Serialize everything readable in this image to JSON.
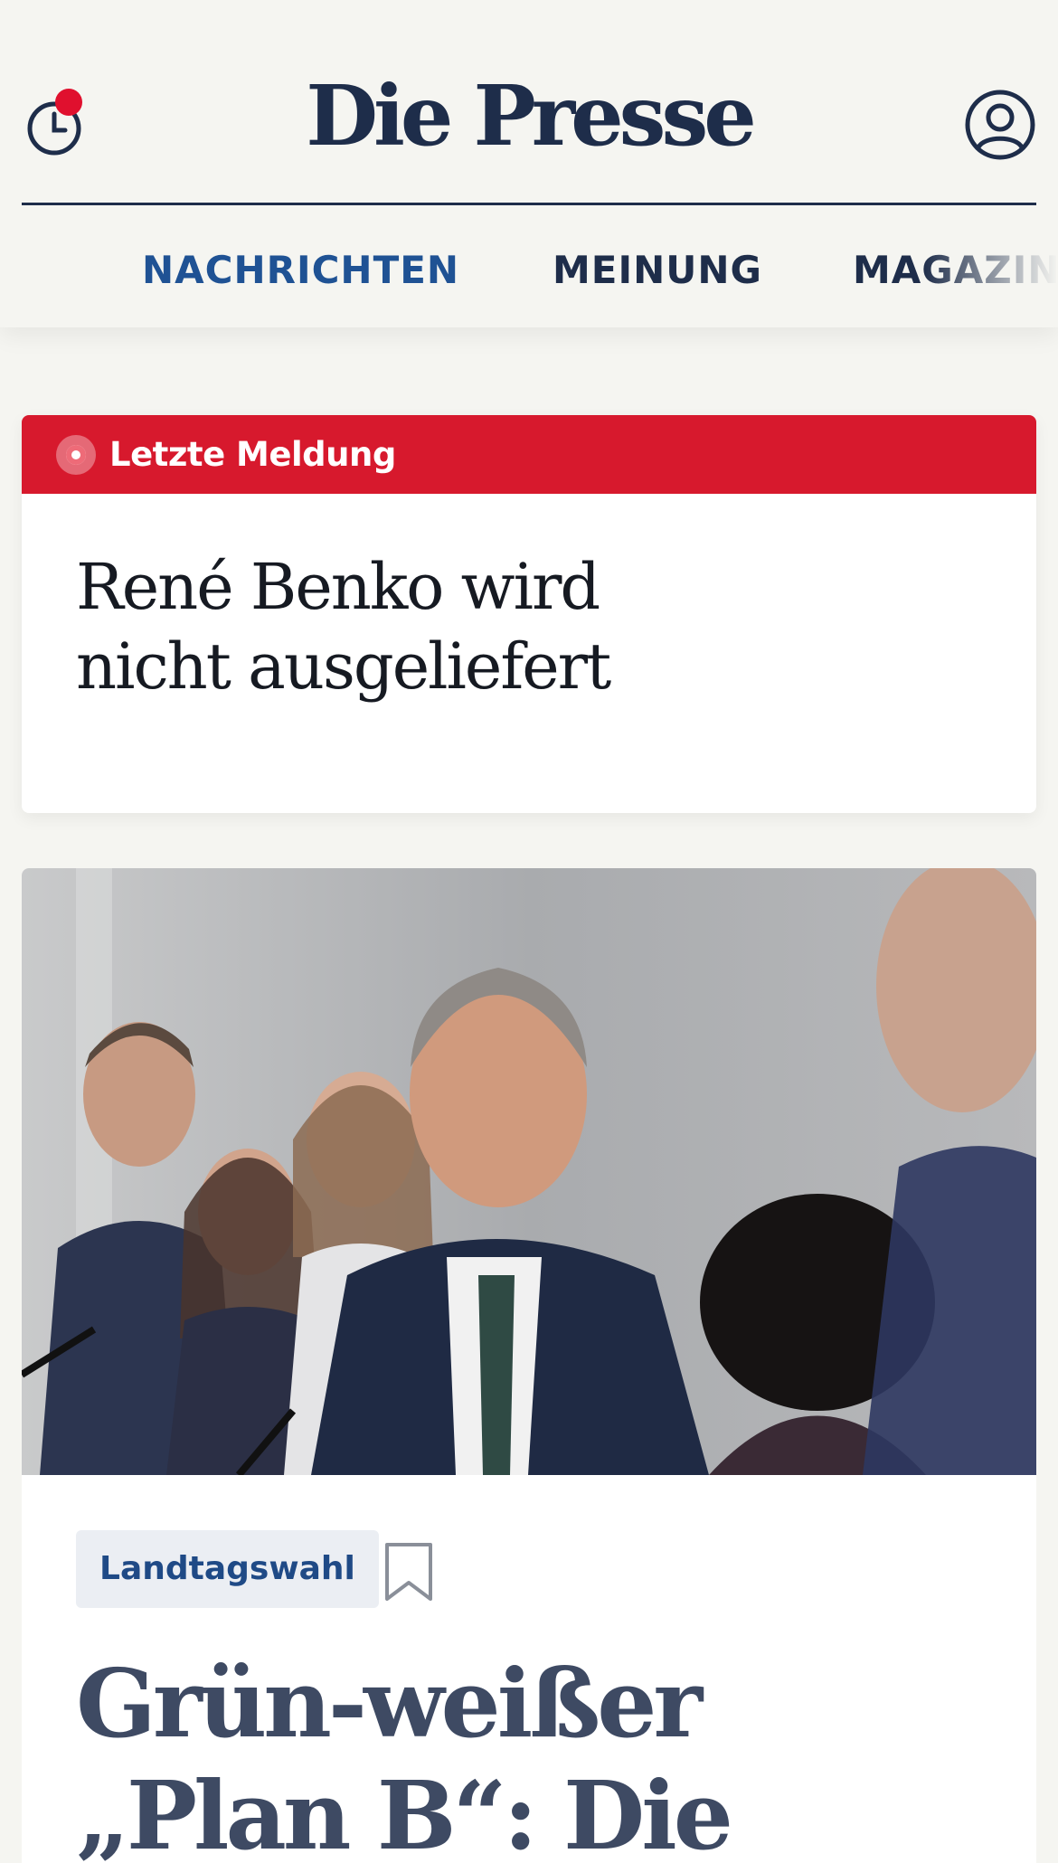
{
  "header": {
    "logo": "Die Presse",
    "history_icon": "clock-icon",
    "notification_dot_color": "#e0102e",
    "account_icon": "user-circle-icon",
    "menu_icon": "hamburger-menu-icon"
  },
  "nav": {
    "items": [
      {
        "label": "NACHRICHTEN",
        "active": true
      },
      {
        "label": "MEINUNG",
        "active": false
      },
      {
        "label": "MAGAZIN",
        "active": false
      }
    ]
  },
  "breaking": {
    "label": "Letzte Meldung",
    "headline": "René Benko wird nicht ausgeliefert",
    "accent_color": "#d7192d"
  },
  "article": {
    "image_alt": "Pressekonferenz mit mehreren Personen",
    "tag": "Landtagswahl",
    "bookmark_icon": "bookmark-icon",
    "headline": "Grün-weißer „Plan B“: Die"
  },
  "colors": {
    "brand_navy": "#1e2d4a",
    "nav_active": "#1f5294",
    "background": "#f5f5f1"
  }
}
